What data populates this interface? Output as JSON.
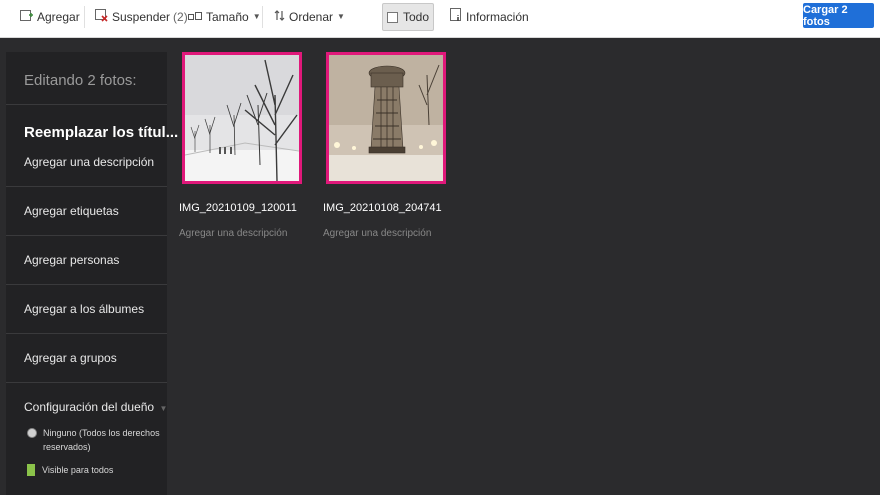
{
  "toolbar": {
    "add_label": "Agregar",
    "suspend_label": "Suspender",
    "suspend_count": "(2)",
    "size_label": "Tamaño",
    "sort_label": "Ordenar",
    "all_label": "Todo",
    "info_label": "Información",
    "upload_label": "Cargar 2 fotos"
  },
  "sidebar": {
    "heading": "Editando 2 fotos:",
    "replace_titles": "Reemplazar los títul...",
    "add_description": "Agregar una descripción",
    "add_tags": "Agregar etiquetas",
    "add_people": "Agregar personas",
    "add_albums": "Agregar a los álbumes",
    "add_groups": "Agregar a grupos",
    "owner_settings": "Configuración del dueño",
    "license_line1": "Ninguno (Todos los derechos",
    "license_line2": "reservados)",
    "visibility": "Visible para todos"
  },
  "photos": [
    {
      "name": "IMG_20210109_120011",
      "description_placeholder": "Agregar una descripción"
    },
    {
      "name": "IMG_20210108_204741",
      "description_placeholder": "Agregar una descripción"
    }
  ],
  "colors": {
    "accent": "#1f6fd8",
    "selection": "#e0187a",
    "background": "#2b2b2d",
    "sidebar": "#222224"
  }
}
